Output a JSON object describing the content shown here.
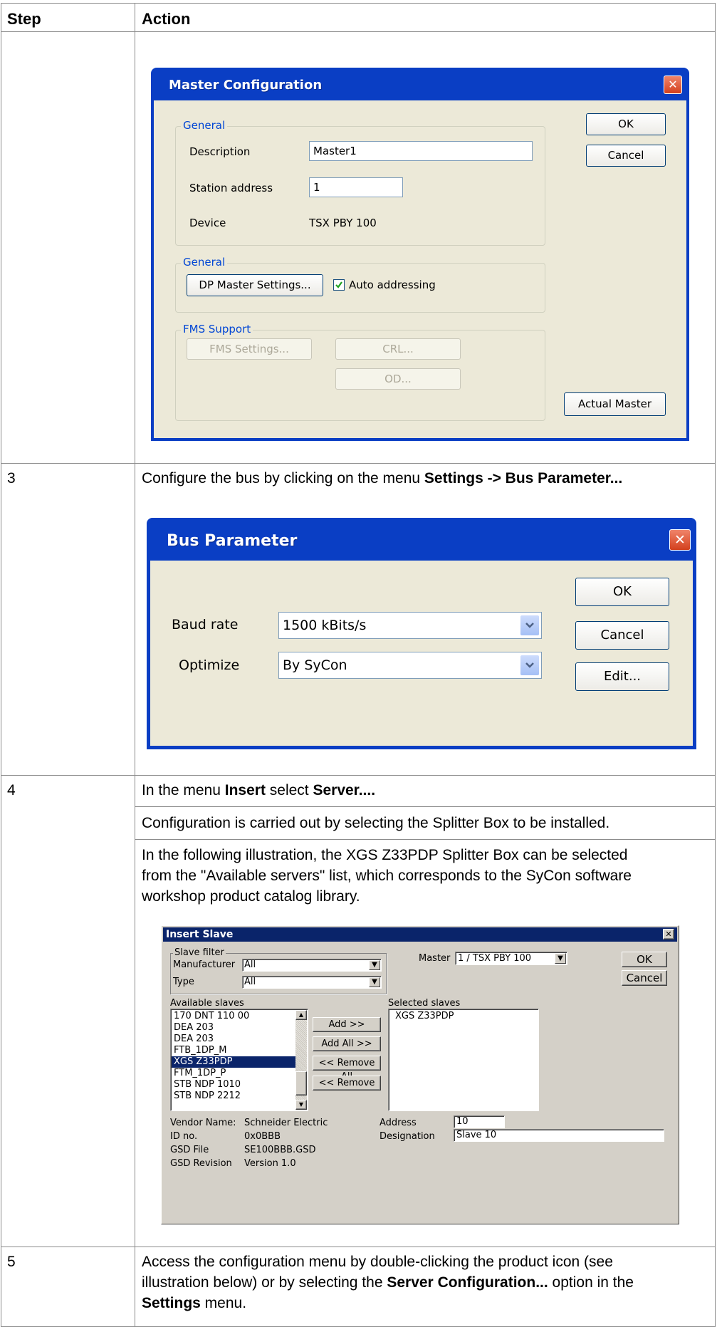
{
  "table": {
    "header_step": "Step",
    "header_action": "Action"
  },
  "row3": {
    "step": "3",
    "text_before": "Configure the bus by clicking on the menu ",
    "text_bold": "Settings -> Bus Parameter..."
  },
  "row4": {
    "step": "4",
    "p1_before": "In the menu ",
    "p1_bold1": "Insert",
    "p1_mid": " select ",
    "p1_bold2": "Server....",
    "p2": "Configuration is carried out by selecting the Splitter Box to be installed.",
    "p3_line1": "In the following illustration, the XGS Z33PDP Splitter Box can be selected",
    "p3_line2": "from the \"Available servers\" list, which corresponds to the SyCon software",
    "p3_line3": "workshop product catalog library."
  },
  "row5": {
    "step": "5",
    "line1": "Access the configuration menu by double-clicking the product icon (see",
    "line2_before": "illustration below) or by selecting the ",
    "line2_bold": "Server Configuration...",
    "line2_after": " option in the",
    "line3_bold": "Settings",
    "line3_after": " menu."
  },
  "master_config": {
    "title": "Master Configuration",
    "close": "✕",
    "group_general": "General",
    "description_label": "Description",
    "description_value": "Master1",
    "station_label": "Station address",
    "station_value": "1",
    "device_label": "Device",
    "device_value": "TSX PBY 100",
    "group_general2": "General",
    "dp_master_btn": "DP Master Settings...",
    "auto_addressing_label": "Auto addressing",
    "auto_addressing_checked": true,
    "group_fms": "FMS Support",
    "fms_settings_btn": "FMS Settings...",
    "crl_btn": "CRL...",
    "od_btn": "OD...",
    "ok_btn": "OK",
    "cancel_btn": "Cancel",
    "actual_master_btn": "Actual Master"
  },
  "bus_param": {
    "title": "Bus Parameter",
    "close": "✕",
    "baud_label": "Baud rate",
    "baud_value": "1500 kBits/s",
    "optimize_label": "Optimize",
    "optimize_value": "By SyCon",
    "ok_btn": "OK",
    "cancel_btn": "Cancel",
    "edit_btn": "Edit..."
  },
  "insert_slave": {
    "title": "Insert Slave",
    "close": "✕",
    "slave_filter_label": "Slave filter",
    "manufacturer_label": "Manufacturer",
    "manufacturer_value": "All",
    "type_label": "Type",
    "type_value": "All",
    "master_label": "Master",
    "master_value": "1 / TSX PBY 100",
    "ok_btn": "OK",
    "cancel_btn": "Cancel",
    "available_label": "Available slaves",
    "available_items": [
      "170 DNT 110 00",
      "DEA 203",
      "DEA 203",
      "FTB_1DP_M",
      "XGS Z33PDP",
      "FTM_1DP_P",
      "STB NDP 1010",
      "STB NDP 2212"
    ],
    "selected_index": 4,
    "add_btn": "Add >>",
    "add_all_btn": "Add All >>",
    "remove_all_btn": "<< Remove All",
    "remove_btn": "<< Remove",
    "selected_label": "Selected slaves",
    "selected_items": [
      "XGS Z33PDP"
    ],
    "vendor_label": "Vendor Name:",
    "vendor_value": "Schneider Electric",
    "id_label": "ID no.",
    "id_value": "0x0BBB",
    "gsd_file_label": "GSD File",
    "gsd_file_value": "SE100BBB.GSD",
    "gsd_rev_label": "GSD Revision",
    "gsd_rev_value": "Version 1.0",
    "address_label": "Address",
    "address_value": "10",
    "designation_label": "Designation",
    "designation_value": "Slave 10"
  }
}
